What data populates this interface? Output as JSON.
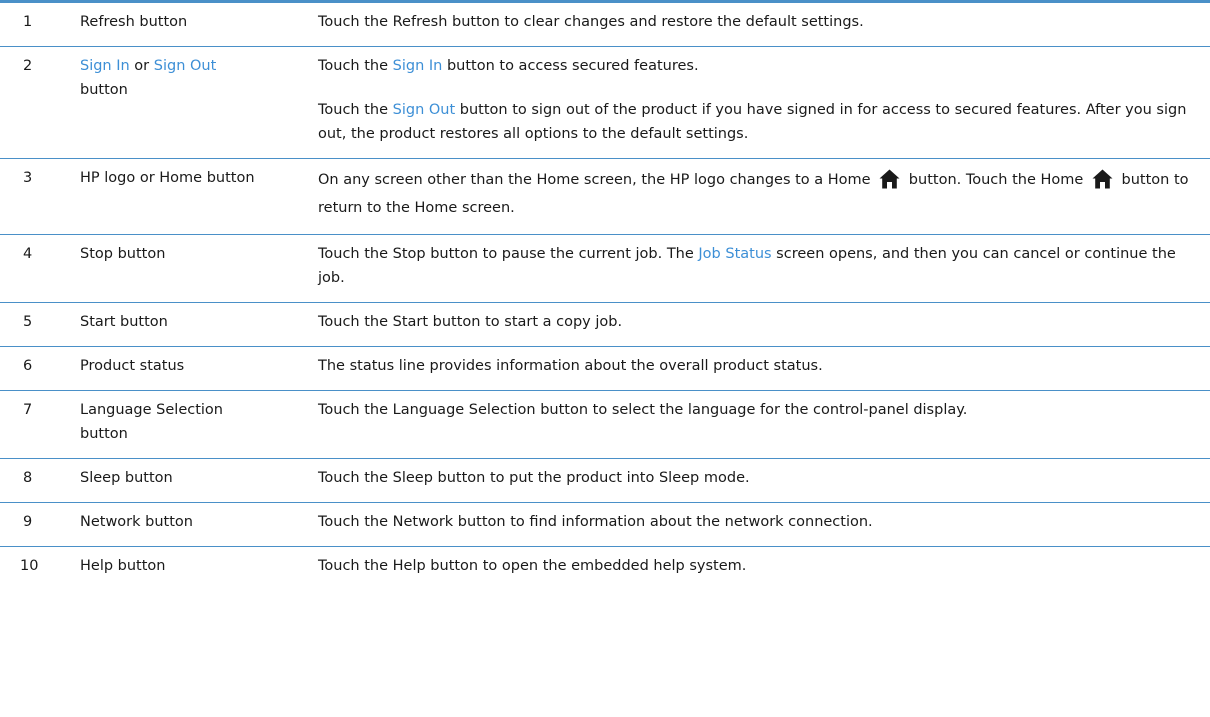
{
  "rows": [
    {
      "num": "1",
      "item": "Refresh button",
      "desc": "Touch the Refresh button to clear changes and restore the default settings."
    },
    {
      "num": "2",
      "item_a": "Sign In",
      "item_or": " or ",
      "item_b": "Sign Out",
      "item_c": "button",
      "p1_a": "Touch the ",
      "p1_link": "Sign In",
      "p1_b": " button to access secured features.",
      "p2_a": "Touch the ",
      "p2_link": "Sign Out",
      "p2_b": " button to sign out of the product if you have signed in for access to secured features. After you sign out, the product restores all options to the default settings."
    },
    {
      "num": "3",
      "item": "HP logo or Home button",
      "d_a": "On any screen other than the Home screen, the HP logo changes to a Home ",
      "d_b": " button. Touch the Home ",
      "d_c": " button to return to the Home screen.",
      "icon": "home-icon"
    },
    {
      "num": "4",
      "item": "Stop button",
      "d_a": "Touch the Stop button to pause the current job. The ",
      "d_link": "Job Status",
      "d_b": " screen opens, and then you can cancel or continue the job."
    },
    {
      "num": "5",
      "item": "Start button",
      "desc": "Touch the Start button to start a copy job."
    },
    {
      "num": "6",
      "item": "Product status",
      "desc": "The status line provides information about the overall product status."
    },
    {
      "num": "7",
      "item": "Language Selection button",
      "desc": "Touch the Language Selection button to select the language for the control-panel display."
    },
    {
      "num": "8",
      "item": "Sleep button",
      "desc": "Touch the Sleep button to put the product into Sleep mode."
    },
    {
      "num": "9",
      "item": "Network button",
      "desc": "Touch the Network button to find information about the network connection."
    },
    {
      "num": "10",
      "item": "Help button",
      "desc": "Touch the Help button to open the embedded help system."
    }
  ],
  "colors": {
    "accent": "#4a90c8",
    "link": "#3d8fd6",
    "text": "#1a1a1a"
  }
}
